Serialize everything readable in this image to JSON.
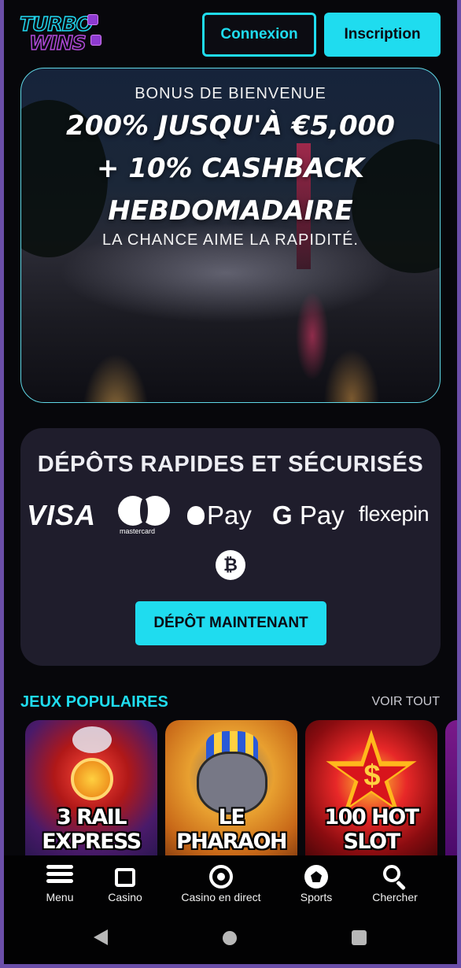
{
  "header": {
    "logo_line1": "TURBO",
    "logo_line2": "WINS",
    "login_label": "Connexion",
    "signup_label": "Inscription"
  },
  "hero": {
    "pre_title": "BONUS DE BIENVENUE",
    "title_line1": "200% JUSQU'À €5,000",
    "title_line2": "+ 10% CASHBACK",
    "title_line3": "HEBDOMADAIRE",
    "tagline": "LA CHANCE AIME LA RAPIDITÉ."
  },
  "deposit": {
    "title": "DÉPÔTS RAPIDES ET SÉCURISÉS",
    "methods": {
      "visa": "VISA",
      "mastercard": "mastercard",
      "apple_pay": "Pay",
      "google_pay_g": "G",
      "google_pay": "Pay",
      "flexepin": "flexepin",
      "bitcoin": "₿"
    },
    "cta_label": "DÉPÔT MAINTENANT"
  },
  "games": {
    "section_title": "JEUX POPULAIRES",
    "see_all": "VOIR TOUT",
    "items": [
      {
        "title": "3 RAIL EXPRESS"
      },
      {
        "title": "LE PHARAOH"
      },
      {
        "title": "100 HOT SLOT"
      }
    ]
  },
  "bottom_nav": {
    "items": [
      {
        "label": "Menu",
        "icon": "menu-icon"
      },
      {
        "label": "Casino",
        "icon": "slot-machine-icon"
      },
      {
        "label": "Casino en direct",
        "icon": "casino-chip-icon"
      },
      {
        "label": "Sports",
        "icon": "soccer-ball-icon"
      },
      {
        "label": "Chercher",
        "icon": "search-icon"
      }
    ]
  },
  "colors": {
    "accent": "#1fdcef",
    "background": "#07070b",
    "card": "#1f1d2c"
  }
}
